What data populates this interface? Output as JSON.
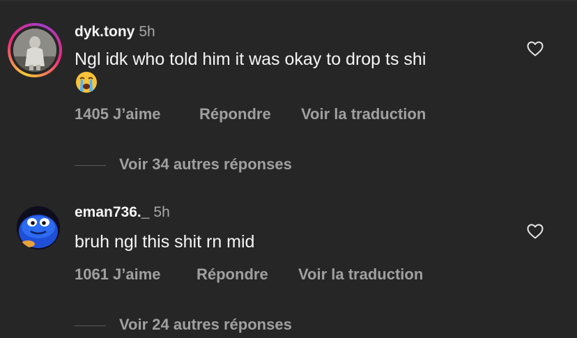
{
  "comments": [
    {
      "username": "dyk.tony",
      "time": "5h",
      "text": "Ngl idk who told him it was okay to drop ts shi",
      "emoji": "loudly-crying-face",
      "likes": "1405 J’aime",
      "reply": "Répondre",
      "translate": "Voir la traduction",
      "view_replies": "Voir 34 autres réponses",
      "avatar_story_ring": true
    },
    {
      "username": "eman736._",
      "time": "5h",
      "text": "bruh ngl this shit rn mid",
      "likes": "1061 J’aime",
      "reply": "Répondre",
      "translate": "Voir la traduction",
      "view_replies": "Voir 24 autres réponses",
      "avatar_story_ring": false
    }
  ],
  "icons": {
    "like": "heart-outline-icon"
  },
  "colors": {
    "background": "#262626",
    "primary_text": "#f5f5f5",
    "secondary_text": "#a0a0a0",
    "story_ring_gradient": [
      "#f9ce34",
      "#ee2a7b",
      "#a13cc7"
    ]
  }
}
